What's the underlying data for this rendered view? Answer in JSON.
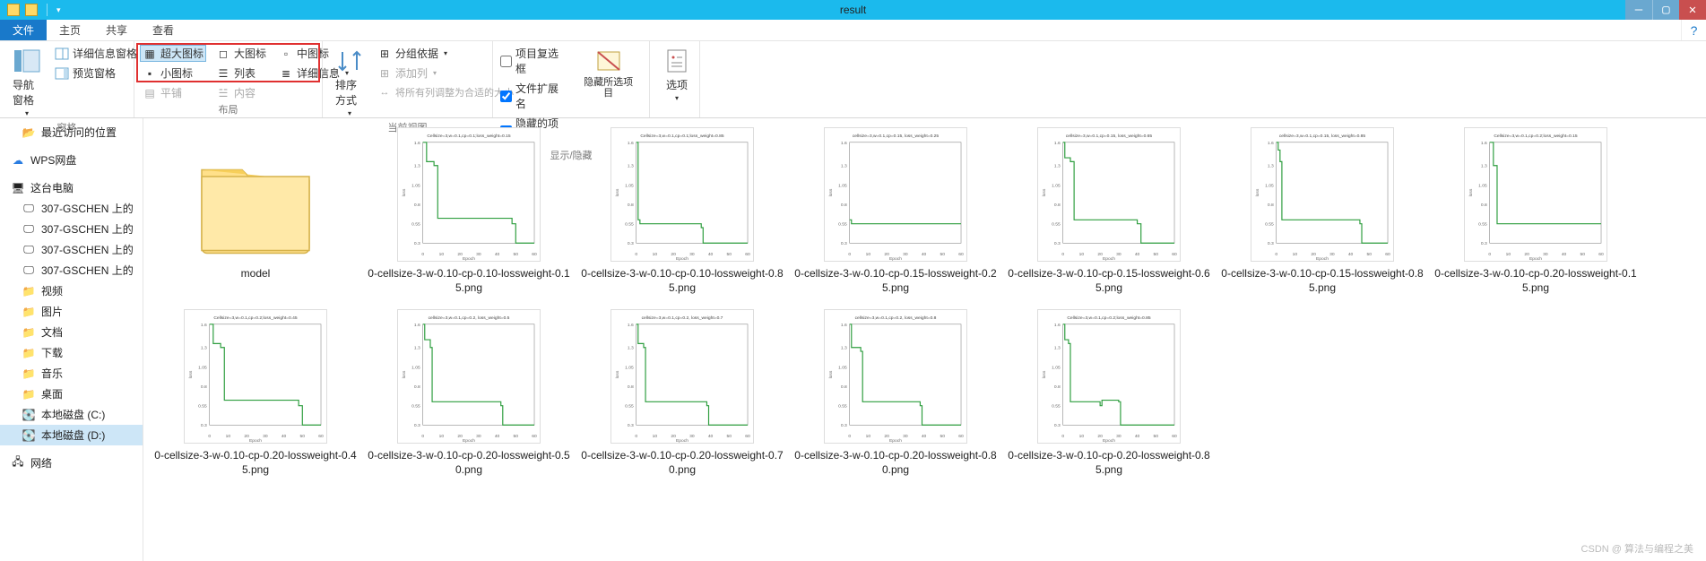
{
  "window": {
    "title": "result"
  },
  "tabs": {
    "file": "文件",
    "home": "主页",
    "share": "共享",
    "view": "查看"
  },
  "ribbon": {
    "panes": {
      "nav_pane": "导航窗格",
      "preview_pane": "预览窗格",
      "detail_pane": "详细信息窗格",
      "group_label": "窗格"
    },
    "layout": {
      "extra_large": "超大图标",
      "large": "大图标",
      "medium": "中图标",
      "small": "小图标",
      "list": "列表",
      "details": "详细信息",
      "tiles": "平铺",
      "content": "内容",
      "group_label": "布局"
    },
    "arrange": {
      "sort": "排序方式",
      "group_by": "分组依据",
      "add_col": "添加列",
      "fit_cols": "将所有列调整为合适的大小",
      "group_label": "当前视图"
    },
    "showhide": {
      "item_checkboxes": "项目复选框",
      "extensions": "文件扩展名",
      "hidden_items": "隐藏的项目",
      "hide_selected": "隐藏所选项目",
      "group_label": "显示/隐藏"
    },
    "options": {
      "label": "选项"
    }
  },
  "nav": {
    "recent": "最近访问的位置",
    "wps": "WPS网盘",
    "thispc": "这台电脑",
    "gs1": "307-GSCHEN 上的",
    "gs2": "307-GSCHEN 上的",
    "gs3": "307-GSCHEN 上的",
    "gs4": "307-GSCHEN 上的",
    "videos": "视频",
    "pictures": "图片",
    "documents": "文档",
    "downloads": "下载",
    "music": "音乐",
    "desktop": "桌面",
    "disk_c": "本地磁盘 (C:)",
    "disk_d": "本地磁盘 (D:)",
    "network": "网络"
  },
  "files": [
    {
      "type": "folder",
      "name": "model"
    },
    {
      "type": "chart",
      "name": "0-cellsize-3-w-0.10-cp-0.10-lossweight-0.15.png",
      "title": "Cellsize=3,w=0.1,cp=0.1;loss_weight=0.15",
      "pts": [
        [
          0,
          1.6
        ],
        [
          2,
          1.35
        ],
        [
          6,
          1.3
        ],
        [
          8,
          0.62
        ],
        [
          48,
          0.55
        ],
        [
          50,
          0.3
        ],
        [
          60,
          0.3
        ]
      ]
    },
    {
      "type": "chart",
      "name": "0-cellsize-3-w-0.10-cp-0.10-lossweight-0.85.png",
      "title": "Cellsize=3,w=0.1,cp=0.1;loss_weight=0.85",
      "pts": [
        [
          0,
          1.6
        ],
        [
          1,
          0.6
        ],
        [
          2,
          0.55
        ],
        [
          35,
          0.5
        ],
        [
          36,
          0.3
        ],
        [
          60,
          0.3
        ]
      ]
    },
    {
      "type": "chart",
      "name": "0-cellsize-3-w-0.10-cp-0.15-lossweight-0.25.png",
      "title": "cellsize=3,w=0.1,cp=0.15, loss_weight=0.25",
      "pts": [
        [
          0,
          0.6
        ],
        [
          1,
          0.55
        ],
        [
          60,
          0.55
        ]
      ],
      "ylim": [
        0.3,
        1.6
      ]
    },
    {
      "type": "chart",
      "name": "0-cellsize-3-w-0.10-cp-0.15-lossweight-0.65.png",
      "title": "cellsize=3,w=0.1,cp=0.15, loss_weight=0.65",
      "pts": [
        [
          0,
          1.6
        ],
        [
          1,
          1.4
        ],
        [
          4,
          1.35
        ],
        [
          6,
          0.6
        ],
        [
          40,
          0.55
        ],
        [
          42,
          0.3
        ],
        [
          60,
          0.3
        ]
      ]
    },
    {
      "type": "chart",
      "name": "0-cellsize-3-w-0.10-cp-0.15-lossweight-0.85.png",
      "title": "cellsize=3,w=0.1,cp=0.15, loss_weight=0.85",
      "pts": [
        [
          0,
          1.6
        ],
        [
          1,
          1.5
        ],
        [
          2,
          1.35
        ],
        [
          3,
          0.6
        ],
        [
          45,
          0.55
        ],
        [
          46,
          0.3
        ],
        [
          60,
          0.3
        ]
      ]
    },
    {
      "type": "chart",
      "name": "0-cellsize-3-w-0.10-cp-0.20-lossweight-0.15.png",
      "title": "Cellsize=3,w=0.1,cp=0.2;loss_weight=0.15",
      "pts": [
        [
          0,
          1.6
        ],
        [
          2,
          1.3
        ],
        [
          4,
          0.55
        ],
        [
          60,
          0.55
        ]
      ],
      "ylim": [
        0.3,
        1.6
      ]
    },
    {
      "type": "chart",
      "name": "0-cellsize-3-w-0.10-cp-0.20-lossweight-0.45.png",
      "title": "Cellsize=3,w=0.1,cp=0.2;loss_weight=0.45",
      "pts": [
        [
          0,
          1.6
        ],
        [
          2,
          1.35
        ],
        [
          6,
          1.3
        ],
        [
          8,
          0.62
        ],
        [
          48,
          0.55
        ],
        [
          50,
          0.3
        ],
        [
          60,
          0.3
        ]
      ]
    },
    {
      "type": "chart",
      "name": "0-cellsize-3-w-0.10-cp-0.20-lossweight-0.50.png",
      "title": "cellsize=3,w=0.1,cp=0.2, loss_weight=0.5",
      "pts": [
        [
          0,
          1.6
        ],
        [
          1,
          1.4
        ],
        [
          4,
          1.3
        ],
        [
          5,
          0.6
        ],
        [
          42,
          0.55
        ],
        [
          43,
          0.3
        ],
        [
          60,
          0.3
        ]
      ]
    },
    {
      "type": "chart",
      "name": "0-cellsize-3-w-0.10-cp-0.20-lossweight-0.70.png",
      "title": "cellsize=3,w=0.1,cp=0.2, loss_weight=0.7",
      "pts": [
        [
          0,
          1.6
        ],
        [
          1,
          1.35
        ],
        [
          4,
          1.3
        ],
        [
          5,
          0.6
        ],
        [
          38,
          0.55
        ],
        [
          39,
          0.3
        ],
        [
          60,
          0.3
        ]
      ]
    },
    {
      "type": "chart",
      "name": "0-cellsize-3-w-0.10-cp-0.20-lossweight-0.80.png",
      "title": "cellsize=3,w=0.1,cp=0.2, loss_weight=0.8",
      "pts": [
        [
          0,
          1.6
        ],
        [
          1,
          1.3
        ],
        [
          6,
          1.25
        ],
        [
          7,
          0.6
        ],
        [
          38,
          0.55
        ],
        [
          39,
          0.3
        ],
        [
          60,
          0.3
        ]
      ]
    },
    {
      "type": "chart",
      "name": "0-cellsize-3-w-0.10-cp-0.20-lossweight-0.85.png",
      "title": "Cellsize=3,w=0.1,cp=0.2;loss_weight=0.85",
      "pts": [
        [
          0,
          1.6
        ],
        [
          1,
          1.4
        ],
        [
          3,
          1.35
        ],
        [
          4,
          0.6
        ],
        [
          20,
          0.55
        ],
        [
          21,
          0.62
        ],
        [
          30,
          0.6
        ],
        [
          31,
          0.3
        ],
        [
          60,
          0.3
        ]
      ]
    }
  ],
  "chart_data": {
    "type": "line",
    "xlabel": "Epoch",
    "ylabel": "loss",
    "xlim": [
      0,
      60
    ],
    "ylim_default": [
      0.3,
      1.6
    ],
    "xticks": [
      0,
      10,
      20,
      30,
      40,
      50,
      60
    ],
    "yticks": [
      0.3,
      0.55,
      0.8,
      1.05,
      1.3,
      1.6
    ],
    "note": "Each file thumbnail is a loss-vs-epoch step curve; per-file points are in files[].pts as [epoch, loss] pairs."
  },
  "watermark": "CSDN @ 算法与编程之美"
}
